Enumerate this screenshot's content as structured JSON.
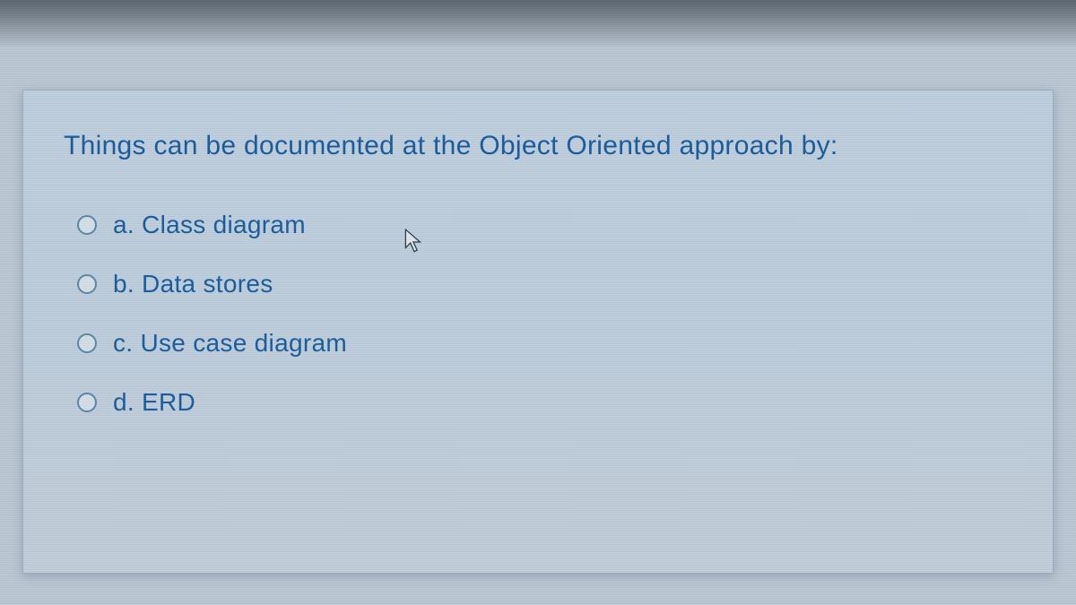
{
  "question": {
    "text": "Things can be documented at the Object Oriented approach by:",
    "options": [
      {
        "letter": "a.",
        "label": "Class diagram"
      },
      {
        "letter": "b.",
        "label": "Data stores"
      },
      {
        "letter": "c.",
        "label": "Use case diagram"
      },
      {
        "letter": "d.",
        "label": "ERD"
      }
    ]
  }
}
